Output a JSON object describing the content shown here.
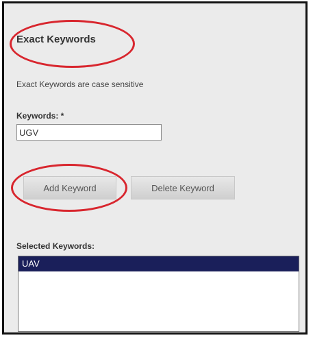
{
  "section": {
    "title": "Exact Keywords",
    "subtitle": "Exact Keywords are case sensitive"
  },
  "keywords": {
    "label": "Keywords: *",
    "value": "UGV"
  },
  "buttons": {
    "add_label": "Add Keyword",
    "delete_label": "Delete Keyword"
  },
  "selected": {
    "label": "Selected Keywords:",
    "items": [
      "UAV"
    ],
    "selected_index": 0
  },
  "colors": {
    "highlight_ring": "#d8262e",
    "selected_row_bg": "#1a1f5a",
    "panel_bg": "#ebebeb"
  }
}
